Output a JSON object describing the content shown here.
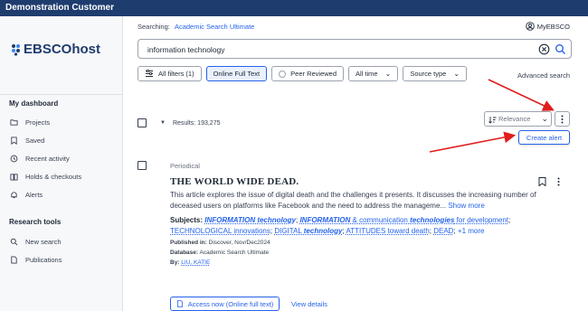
{
  "topbar": {
    "title": "Demonstration Customer"
  },
  "sidebar": {
    "logo_text": "EBSCOhost",
    "dashboard_heading": "My dashboard",
    "dashboard_items": [
      {
        "label": "Projects",
        "icon": "folder-icon"
      },
      {
        "label": "Saved",
        "icon": "bookmark-icon"
      },
      {
        "label": "Recent activity",
        "icon": "history-icon"
      },
      {
        "label": "Holds & checkouts",
        "icon": "book-icon"
      },
      {
        "label": "Alerts",
        "icon": "bell-icon"
      }
    ],
    "research_heading": "Research tools",
    "research_items": [
      {
        "label": "New search",
        "icon": "search-icon"
      },
      {
        "label": "Publications",
        "icon": "document-icon"
      }
    ]
  },
  "header": {
    "searching_label": "Searching:",
    "database": "Academic Search Ultimate",
    "myebsco": "MyEBSCO"
  },
  "search": {
    "value": "information technology"
  },
  "filters": {
    "all_filters": "All filters (1)",
    "online_full_text": "Online Full Text",
    "peer_reviewed": "Peer Reviewed",
    "all_time": "All time",
    "source_type": "Source type",
    "advanced": "Advanced search"
  },
  "results": {
    "count_text": "Results: 193,275",
    "sort": "Relevance",
    "create_alert": "Create alert"
  },
  "result": {
    "type": "Periodical",
    "title": "THE WORLD WIDE DEAD.",
    "abstract": "This article explores the issue of digital death and the challenges it presents. It discusses the increasing number of deceased users on platforms like Facebook and the need to address the manageme...",
    "show_more": "Show more",
    "subjects_label": "Subjects:",
    "subjects": {
      "s1": "INFORMATION technology",
      "s2a": "INFORMATION",
      "s2b": " & communication ",
      "s2c": "technologies",
      "s2d": " for development",
      "s3": "TECHNOLOGICAL innovations",
      "s4a": "DIGITAL ",
      "s4b": "technology",
      "s5": "ATTITUDES toward death",
      "s6": "DEAD",
      "more": "+1 more"
    },
    "published_label": "Published in:",
    "published": "Discover, Nov/Dec2024",
    "database_label": "Database:",
    "database": "Academic Search Ultimate",
    "by_label": "By:",
    "author": "LIU, KATIE",
    "access_button": "Access now (Online full text)",
    "view_details": "View details"
  },
  "colors": {
    "topbar": "#1f3c6e",
    "link": "#2563eb",
    "arrow": "#e11d1d"
  }
}
